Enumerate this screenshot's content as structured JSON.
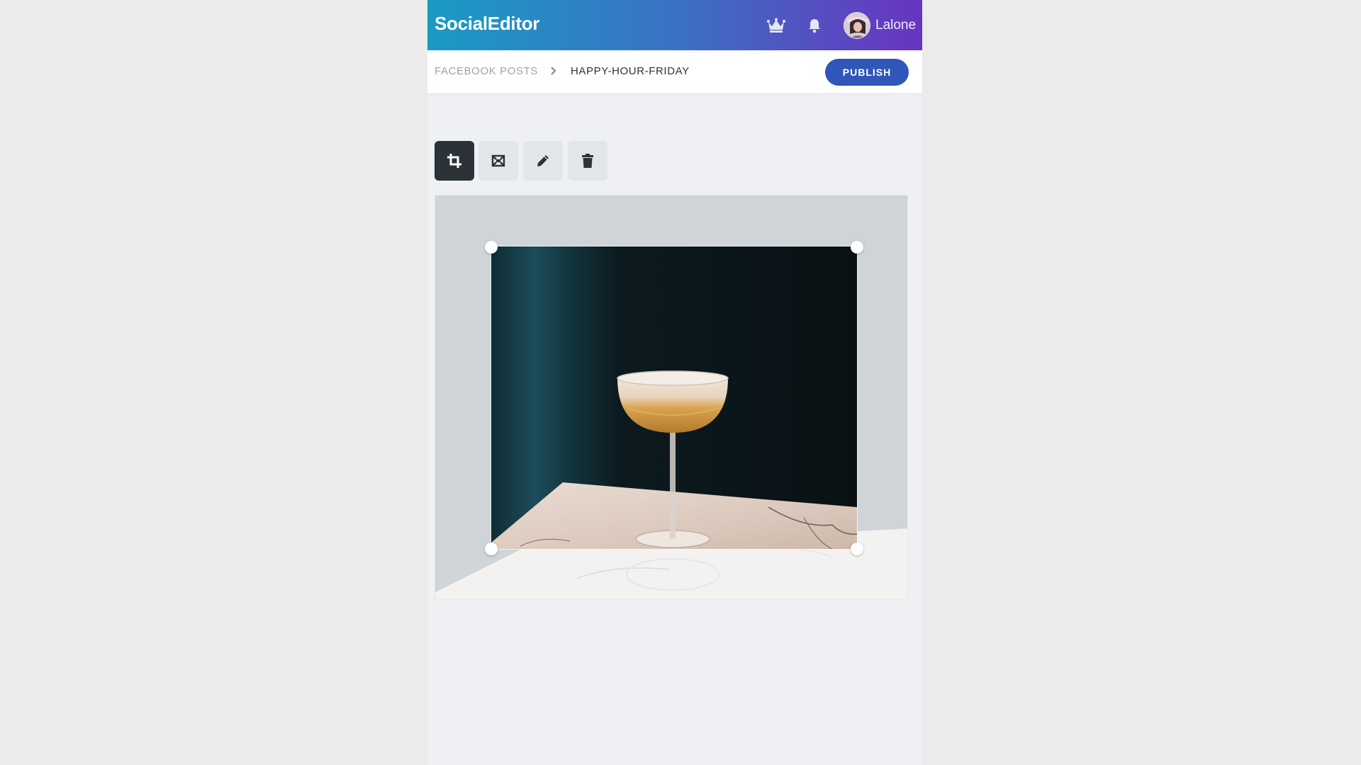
{
  "header": {
    "brand": "SocialEditor",
    "username": "Lalone",
    "icons": [
      "crown-icon",
      "bell-icon",
      "avatar"
    ]
  },
  "breadcrumb": {
    "root": "FACEBOOK POSTS",
    "separator_icon": "chevron-right-icon",
    "current": "HAPPY-HOUR-FRIDAY"
  },
  "actions": {
    "publish_label": "PUBLISH"
  },
  "toolbar": {
    "tools": [
      {
        "icon": "crop-icon",
        "active": true
      },
      {
        "icon": "resize-image-icon",
        "active": false
      },
      {
        "icon": "pencil-icon",
        "active": false
      },
      {
        "icon": "trash-icon",
        "active": false
      }
    ]
  },
  "colors": {
    "header_gradient_start": "#1a9bc4",
    "header_gradient_end": "#6934c0",
    "publish_button": "#2f56b8",
    "active_tool": "#2c3338",
    "inactive_tool": "#e2e6ea",
    "workspace": "#eef0f3"
  }
}
